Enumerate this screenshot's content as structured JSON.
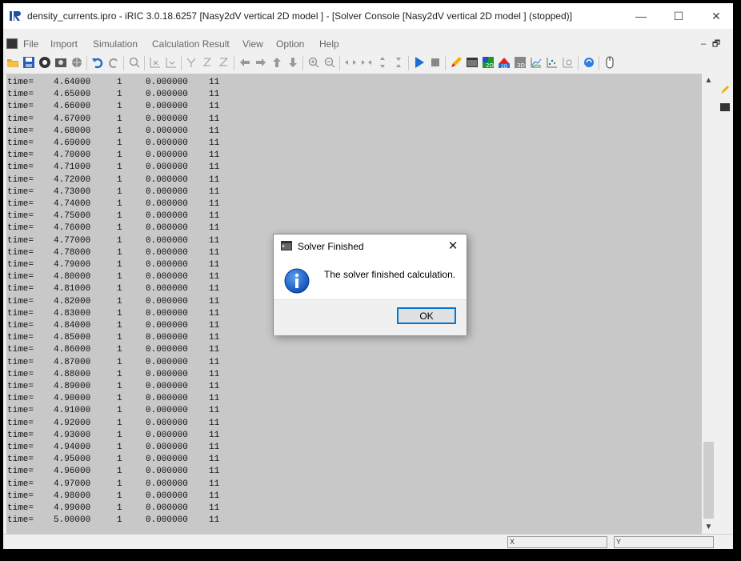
{
  "window": {
    "title": "density_currents.ipro - iRIC 3.0.18.6257 [Nasy2dV vertical 2D model ] - [Solver Console [Nasy2dV vertical 2D model ] (stopped)]",
    "minimize": "—",
    "maximize": "☐",
    "close": "✕"
  },
  "menu": {
    "items": [
      "File",
      "Import",
      "Simulation",
      "Calculation Result",
      "View",
      "Option",
      "Help"
    ],
    "mdi_minimize": "–",
    "mdi_restore": "🗗"
  },
  "toolbar": {
    "icons": [
      "open-folder-icon",
      "save-icon",
      "record-icon",
      "settings-icon",
      "globe-icon",
      "undo-icon",
      "redo-icon",
      "zoom-icon",
      "fit-x-icon",
      "fit-y-icon",
      "axis-x-icon",
      "axis-y-icon",
      "axis-z-icon",
      "arrow-left-icon",
      "arrow-right-icon",
      "arrow-up-icon",
      "arrow-down-icon",
      "zoom-in-icon",
      "zoom-out-icon",
      "pan-h-icon",
      "pan-h2-icon",
      "pan-v-icon",
      "pan-v2-icon",
      "run-icon",
      "stop-icon",
      "pencil-icon",
      "console-icon",
      "2d-icon",
      "2d-alt-icon",
      "3d-icon",
      "graph-icon",
      "scatter-icon",
      "window-icon",
      "refresh-icon",
      "mouse-icon"
    ]
  },
  "console": {
    "rows": [
      {
        "label": "time=",
        "time": "4.64000",
        "n": "1",
        "value": "0.000000",
        "iter": "11"
      },
      {
        "label": "time=",
        "time": "4.65000",
        "n": "1",
        "value": "0.000000",
        "iter": "11"
      },
      {
        "label": "time=",
        "time": "4.66000",
        "n": "1",
        "value": "0.000000",
        "iter": "11"
      },
      {
        "label": "time=",
        "time": "4.67000",
        "n": "1",
        "value": "0.000000",
        "iter": "11"
      },
      {
        "label": "time=",
        "time": "4.68000",
        "n": "1",
        "value": "0.000000",
        "iter": "11"
      },
      {
        "label": "time=",
        "time": "4.69000",
        "n": "1",
        "value": "0.000000",
        "iter": "11"
      },
      {
        "label": "time=",
        "time": "4.70000",
        "n": "1",
        "value": "0.000000",
        "iter": "11"
      },
      {
        "label": "time=",
        "time": "4.71000",
        "n": "1",
        "value": "0.000000",
        "iter": "11"
      },
      {
        "label": "time=",
        "time": "4.72000",
        "n": "1",
        "value": "0.000000",
        "iter": "11"
      },
      {
        "label": "time=",
        "time": "4.73000",
        "n": "1",
        "value": "0.000000",
        "iter": "11"
      },
      {
        "label": "time=",
        "time": "4.74000",
        "n": "1",
        "value": "0.000000",
        "iter": "11"
      },
      {
        "label": "time=",
        "time": "4.75000",
        "n": "1",
        "value": "0.000000",
        "iter": "11"
      },
      {
        "label": "time=",
        "time": "4.76000",
        "n": "1",
        "value": "0.000000",
        "iter": "11"
      },
      {
        "label": "time=",
        "time": "4.77000",
        "n": "1",
        "value": "0.000000",
        "iter": "11"
      },
      {
        "label": "time=",
        "time": "4.78000",
        "n": "1",
        "value": "0.000000",
        "iter": "11"
      },
      {
        "label": "time=",
        "time": "4.79000",
        "n": "1",
        "value": "0.000000",
        "iter": "11"
      },
      {
        "label": "time=",
        "time": "4.80000",
        "n": "1",
        "value": "0.000000",
        "iter": "11"
      },
      {
        "label": "time=",
        "time": "4.81000",
        "n": "1",
        "value": "0.000000",
        "iter": "11"
      },
      {
        "label": "time=",
        "time": "4.82000",
        "n": "1",
        "value": "0.000000",
        "iter": "11"
      },
      {
        "label": "time=",
        "time": "4.83000",
        "n": "1",
        "value": "0.000000",
        "iter": "11"
      },
      {
        "label": "time=",
        "time": "4.84000",
        "n": "1",
        "value": "0.000000",
        "iter": "11"
      },
      {
        "label": "time=",
        "time": "4.85000",
        "n": "1",
        "value": "0.000000",
        "iter": "11"
      },
      {
        "label": "time=",
        "time": "4.86000",
        "n": "1",
        "value": "0.000000",
        "iter": "11"
      },
      {
        "label": "time=",
        "time": "4.87000",
        "n": "1",
        "value": "0.000000",
        "iter": "11"
      },
      {
        "label": "time=",
        "time": "4.88000",
        "n": "1",
        "value": "0.000000",
        "iter": "11"
      },
      {
        "label": "time=",
        "time": "4.89000",
        "n": "1",
        "value": "0.000000",
        "iter": "11"
      },
      {
        "label": "time=",
        "time": "4.90000",
        "n": "1",
        "value": "0.000000",
        "iter": "11"
      },
      {
        "label": "time=",
        "time": "4.91000",
        "n": "1",
        "value": "0.000000",
        "iter": "11"
      },
      {
        "label": "time=",
        "time": "4.92000",
        "n": "1",
        "value": "0.000000",
        "iter": "11"
      },
      {
        "label": "time=",
        "time": "4.93000",
        "n": "1",
        "value": "0.000000",
        "iter": "11"
      },
      {
        "label": "time=",
        "time": "4.94000",
        "n": "1",
        "value": "0.000000",
        "iter": "11"
      },
      {
        "label": "time=",
        "time": "4.95000",
        "n": "1",
        "value": "0.000000",
        "iter": "11"
      },
      {
        "label": "time=",
        "time": "4.96000",
        "n": "1",
        "value": "0.000000",
        "iter": "11"
      },
      {
        "label": "time=",
        "time": "4.97000",
        "n": "1",
        "value": "0.000000",
        "iter": "11"
      },
      {
        "label": "time=",
        "time": "4.98000",
        "n": "1",
        "value": "0.000000",
        "iter": "11"
      },
      {
        "label": "time=",
        "time": "4.99000",
        "n": "1",
        "value": "0.000000",
        "iter": "11"
      },
      {
        "label": "time=",
        "time": "5.00000",
        "n": "1",
        "value": "0.000000",
        "iter": "11"
      }
    ]
  },
  "scrollbar": {
    "up": "▲",
    "down": "▼"
  },
  "statusbar": {
    "field1": "X",
    "field2": "Y"
  },
  "dialog": {
    "title": "Solver Finished",
    "close": "✕",
    "message": "The solver finished calculation.",
    "ok_label": "OK"
  },
  "colors": {
    "console_bg": "#c8c8c8",
    "accent": "#0078d7",
    "run_icon": "#1e6fd0"
  }
}
